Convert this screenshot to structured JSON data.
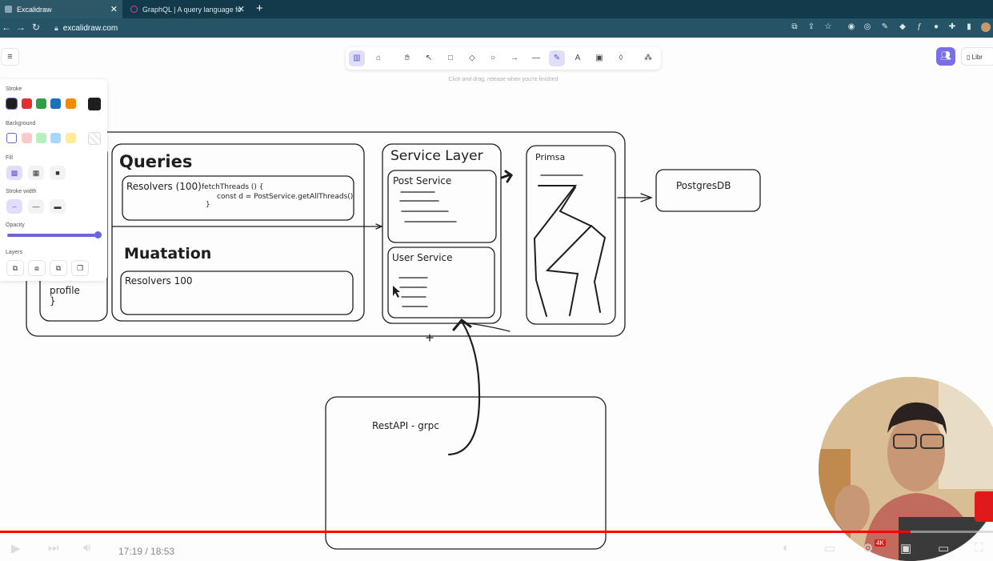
{
  "browser": {
    "tabs": [
      {
        "title": "Excalidraw",
        "active": true
      },
      {
        "title": "GraphQL | A query language fo",
        "active": false
      }
    ],
    "new_tab": "+",
    "url": "excalidraw.com"
  },
  "excalidraw": {
    "hint": "Click and drag, release when you're finished",
    "library_label": "Libr",
    "panel": {
      "stroke_label": "Stroke",
      "background_label": "Background",
      "fill_label": "Fill",
      "stroke_width_label": "Stroke width",
      "opacity_label": "Opacity",
      "layers_label": "Layers",
      "opacity_value": 100,
      "stroke_colors": [
        "#1e1e1e",
        "#e03131",
        "#2f9e44",
        "#1971c2",
        "#f08c00"
      ],
      "stroke_current": "#1e1e1e",
      "background_colors": [
        "#ffffff",
        "#ffc9c9",
        "#b2f2bb",
        "#a5d8ff",
        "#ffec99"
      ]
    }
  },
  "drawing": {
    "queries_title": "Queries",
    "queries_resolver": "Resolvers (100)",
    "code_line1": "fetchThreads () {",
    "code_line2": "const d = PostService.getAllThreads()",
    "code_line3": "}",
    "mutation_title": "Muatation",
    "mutation_resolver": "Resolvers 100",
    "profile_text": "profile",
    "profile_brace": "}",
    "service_layer_title": "Service Layer",
    "post_service": "Post Service",
    "user_service": "User Service",
    "prisma": "Primsa",
    "postgres": "PostgresDB",
    "restapi": "RestAPI - grpc"
  },
  "video": {
    "time": "17:19 / 18:53",
    "progress": 0.917,
    "hd_badge": "4K"
  }
}
